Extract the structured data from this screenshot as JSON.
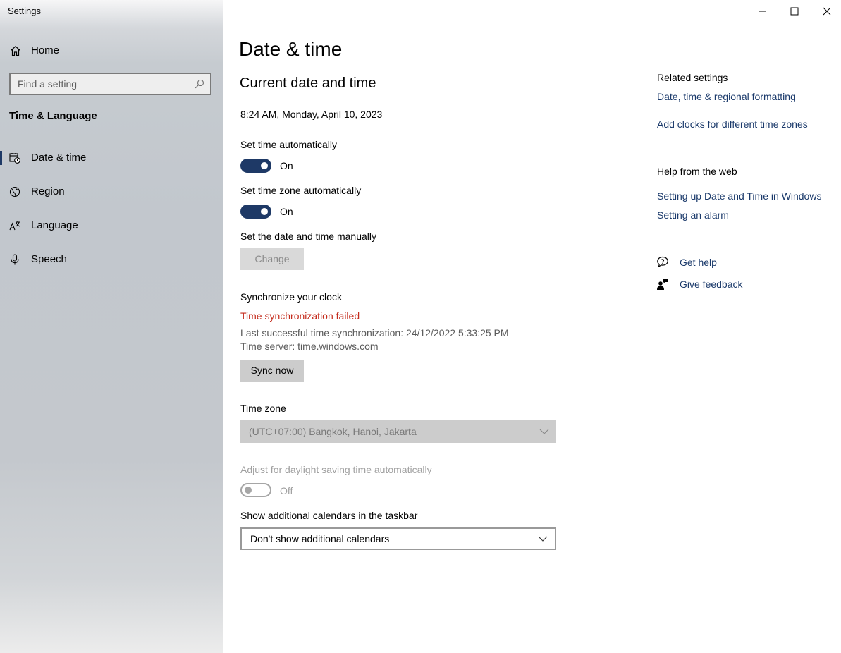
{
  "window": {
    "title": "Settings"
  },
  "sidebar": {
    "home_label": "Home",
    "search_placeholder": "Find a setting",
    "section_label": "Time & Language",
    "items": [
      {
        "label": "Date & time",
        "icon": "calendar-clock-icon",
        "active": true
      },
      {
        "label": "Region",
        "icon": "globe-icon",
        "active": false
      },
      {
        "label": "Language",
        "icon": "language-icon",
        "active": false
      },
      {
        "label": "Speech",
        "icon": "microphone-icon",
        "active": false
      }
    ]
  },
  "main": {
    "page_title": "Date & time",
    "section_title": "Current date and time",
    "current_datetime": "8:24 AM, Monday, April 10, 2023",
    "set_time_auto": {
      "label": "Set time automatically",
      "state": "On"
    },
    "set_timezone_auto": {
      "label": "Set time zone automatically",
      "state": "On"
    },
    "manual": {
      "label": "Set the date and time manually",
      "button": "Change"
    },
    "sync": {
      "label": "Synchronize your clock",
      "error": "Time synchronization failed",
      "last_sync": "Last successful time synchronization: 24/12/2022 5:33:25 PM",
      "server": "Time server: time.windows.com",
      "button": "Sync now"
    },
    "timezone": {
      "label": "Time zone",
      "value": "(UTC+07:00) Bangkok, Hanoi, Jakarta"
    },
    "daylight": {
      "label": "Adjust for daylight saving time automatically",
      "state": "Off"
    },
    "calendars": {
      "label": "Show additional calendars in the taskbar",
      "value": "Don't show additional calendars"
    }
  },
  "related": {
    "heading": "Related settings",
    "links": [
      "Date, time & regional formatting",
      "Add clocks for different time zones"
    ]
  },
  "help_web": {
    "heading": "Help from the web",
    "links": [
      "Setting up Date and Time in Windows",
      "Setting an alarm"
    ]
  },
  "support": {
    "get_help": "Get help",
    "give_feedback": "Give feedback"
  },
  "colors": {
    "accent": "#1e3966",
    "link": "#1b3a6b",
    "error": "#c42b1c"
  }
}
